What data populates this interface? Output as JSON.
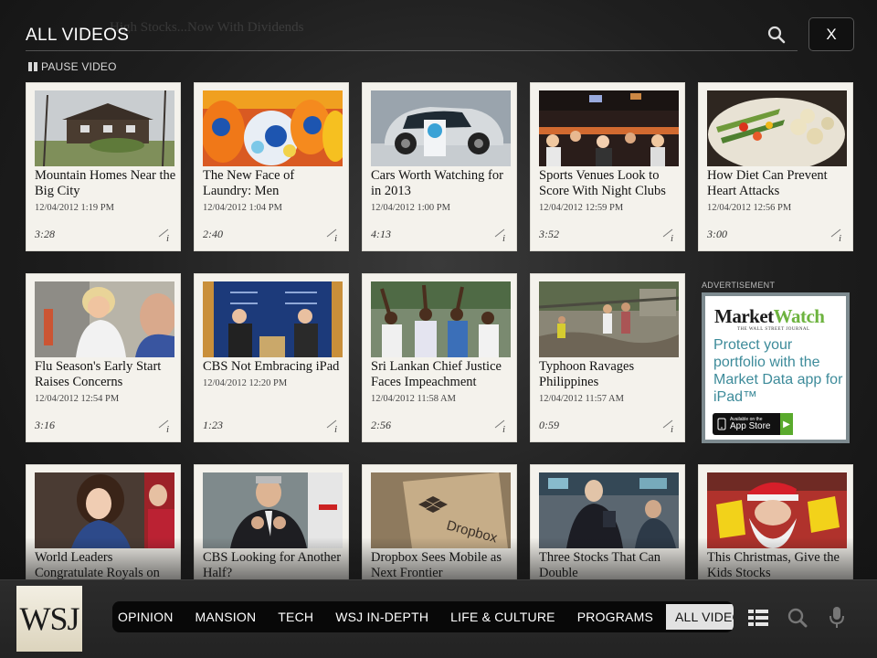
{
  "background_ghost_text": "High Stocks...Now With Dividends",
  "header": {
    "title": "ALL VIDEOS",
    "pause_label": "PAUSE VIDEO",
    "close_label": "X",
    "search_icon": "search-icon"
  },
  "videos": [
    {
      "title": "Mountain Homes Near the Big City",
      "time": "12/04/2012 1:19 PM",
      "duration": "3:28"
    },
    {
      "title": "The New Face of Laundry: Men",
      "time": "12/04/2012 1:04 PM",
      "duration": "2:40"
    },
    {
      "title": "Cars Worth Watching for in 2013",
      "time": "12/04/2012 1:00 PM",
      "duration": "4:13"
    },
    {
      "title": "Sports Venues Look to Score With Night Clubs",
      "time": "12/04/2012 12:59 PM",
      "duration": "3:52"
    },
    {
      "title": "How Diet Can Prevent Heart Attacks",
      "time": "12/04/2012 12:56 PM",
      "duration": "3:00"
    },
    {
      "title": "Flu Season's Early Start Raises Concerns",
      "time": "12/04/2012 12:54 PM",
      "duration": "3:16"
    },
    {
      "title": "CBS Not Embracing iPad",
      "time": "12/04/2012 12:20 PM",
      "duration": "1:23"
    },
    {
      "title": "Sri Lankan Chief Justice Faces Impeachment",
      "time": "12/04/2012 11:58 AM",
      "duration": "2:56"
    },
    {
      "title": "Typhoon Ravages Philippines",
      "time": "12/04/2012 11:57 AM",
      "duration": "0:59"
    },
    {
      "title": "World Leaders Congratulate Royals on",
      "time": "",
      "duration": ""
    },
    {
      "title": "CBS Looking for Another Half?",
      "time": "",
      "duration": ""
    },
    {
      "title": "Dropbox Sees Mobile as Next Frontier",
      "time": "",
      "duration": ""
    },
    {
      "title": "Three Stocks That Can Double",
      "time": "",
      "duration": ""
    },
    {
      "title": "This Christmas, Give the Kids Stocks",
      "time": "",
      "duration": ""
    }
  ],
  "advertisement": {
    "label": "ADVERTISEMENT",
    "brand_market": "Market",
    "brand_watch": "Watch",
    "brand_sub": "THE WALL STREET JOURNAL",
    "copy": "Protect your portfolio with the Market Data app for iPad™",
    "badge_small": "Available on the",
    "badge_big": "App Store"
  },
  "bottom_bar": {
    "logo": "WSJ",
    "sections": [
      "OPINION",
      "MANSION",
      "TECH",
      "WSJ IN-DEPTH",
      "LIFE & CULTURE",
      "PROGRAMS",
      "ALL VIDEOS"
    ],
    "active_section": "ALL VIDEOS",
    "icons": [
      "grid-view-icon",
      "search-icon",
      "microphone-icon"
    ]
  },
  "colors": {
    "card_bg": "#f4f2ec",
    "marketwatch_green": "#6db33f",
    "ad_text": "#3d8b9a",
    "nav_active_bg": "#e2e2e2"
  }
}
